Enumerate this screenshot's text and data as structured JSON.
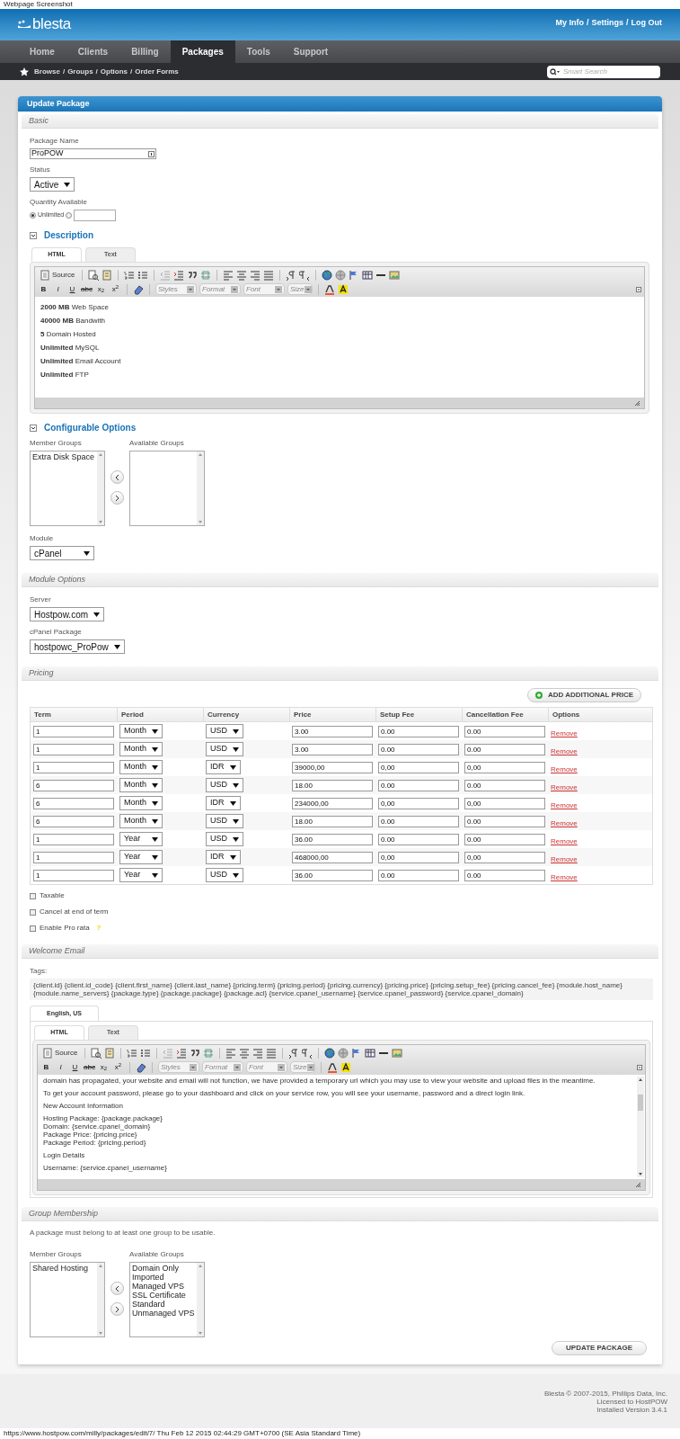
{
  "page_caption": "Webpage Screenshot",
  "header": {
    "logo": "blesta",
    "user_links": [
      "My Info",
      "Settings",
      "Log Out"
    ],
    "separator": "/"
  },
  "nav": [
    {
      "label": "Home",
      "selected": false
    },
    {
      "label": "Clients",
      "selected": false
    },
    {
      "label": "Billing",
      "selected": false
    },
    {
      "label": "Packages",
      "selected": true
    },
    {
      "label": "Tools",
      "selected": false
    },
    {
      "label": "Support",
      "selected": false
    }
  ],
  "subnav": {
    "links": [
      "Browse",
      "Groups",
      "Options",
      "Order Forms"
    ],
    "separator": "/",
    "search_placeholder": "Smart Search"
  },
  "panel_title": "Update Package",
  "basic": {
    "title": "Basic",
    "package_name_label": "Package Name",
    "package_name": "ProPOW",
    "status_label": "Status",
    "status": "Active",
    "quantity_label": "Quantity Available",
    "unlimited_label": "Unlimited",
    "unlimited_selected": true
  },
  "description": {
    "title": "Description",
    "expanded": true,
    "tabs": [
      {
        "label": "HTML",
        "selected": true
      },
      {
        "label": "Text",
        "selected": false
      }
    ],
    "toolbar": {
      "source": "Source",
      "format_buttons": [
        "B",
        "I",
        "U",
        "abc",
        "x$_{2}$",
        "x$^{2}$"
      ],
      "dropdowns": [
        "Styles",
        "Format",
        "Font",
        "Size"
      ]
    },
    "lines": [
      "**2000 MB** Web Space",
      "**40000 MB** Bandwith",
      "**5** Domain Hosted",
      "**Unlimited** MySQL",
      "**Unlimited** Email Account",
      "**Unlimited** FTP"
    ]
  },
  "configurable_options": {
    "title": "Configurable Options",
    "expanded": true,
    "member_groups_label": "Member Groups",
    "member_groups": [
      "Extra Disk Space"
    ],
    "available_groups_label": "Available Groups",
    "module_label": "Module",
    "module": "cPanel"
  },
  "module_options": {
    "title": "Module Options",
    "server_label": "Server",
    "server": "Hostpow.com",
    "package_label": "cPanel Package",
    "package": "hostpowc_ProPow"
  },
  "pricing": {
    "title": "Pricing",
    "add_button": "ADD ADDITIONAL PRICE",
    "columns": [
      "Term",
      "Period",
      "Currency",
      "Price",
      "Setup Fee",
      "Cancellation Fee",
      "Options"
    ],
    "rows": [
      {
        "term": "1",
        "period": "Month",
        "currency": "USD",
        "price": "3.00",
        "setup_fee": "0.00",
        "cancellation_fee": "0.00",
        "action": "Remove"
      },
      {
        "term": "1",
        "period": "Month",
        "currency": "USD",
        "price": "3.00",
        "setup_fee": "0.00",
        "cancellation_fee": "0.00",
        "action": "Remove"
      },
      {
        "term": "1",
        "period": "Month",
        "currency": "IDR",
        "price": "39000,00",
        "setup_fee": "0,00",
        "cancellation_fee": "0,00",
        "action": "Remove"
      },
      {
        "term": "6",
        "period": "Month",
        "currency": "USD",
        "price": "18.00",
        "setup_fee": "0.00",
        "cancellation_fee": "0.00",
        "action": "Remove"
      },
      {
        "term": "6",
        "period": "Month",
        "currency": "IDR",
        "price": "234000,00",
        "setup_fee": "0,00",
        "cancellation_fee": "0,00",
        "action": "Remove"
      },
      {
        "term": "6",
        "period": "Month",
        "currency": "USD",
        "price": "18.00",
        "setup_fee": "0.00",
        "cancellation_fee": "0.00",
        "action": "Remove"
      },
      {
        "term": "1",
        "period": "Year",
        "currency": "USD",
        "price": "36.00",
        "setup_fee": "0.00",
        "cancellation_fee": "0.00",
        "action": "Remove"
      },
      {
        "term": "1",
        "period": "Year",
        "currency": "IDR",
        "price": "468000,00",
        "setup_fee": "0,00",
        "cancellation_fee": "0,00",
        "action": "Remove"
      },
      {
        "term": "1",
        "period": "Year",
        "currency": "USD",
        "price": "36.00",
        "setup_fee": "0.00",
        "cancellation_fee": "0.00",
        "action": "Remove"
      }
    ],
    "checkboxes": [
      {
        "label": "Taxable",
        "checked": false
      },
      {
        "label": "Cancel at end of term",
        "checked": false
      },
      {
        "label": "Enable Pro rata",
        "checked": false,
        "help": "?"
      }
    ]
  },
  "welcome_email": {
    "title": "Welcome Email",
    "tags_label": "Tags:",
    "tags": "{client.id} {client.id_code} {client.first_name} {client.last_name} {pricing.term} {pricing.period} {pricing.currency} {pricing.price} {pricing.setup_fee} {pricing.cancel_fee} {module.host_name} {module.name_servers} {package.type} {package.package} {package.acl} {service.cpanel_username} {service.cpanel_password} {service.cpanel_domain}",
    "language_tabs": [
      {
        "label": "English, US",
        "selected": true
      }
    ],
    "tabs": [
      {
        "label": "HTML",
        "selected": true
      },
      {
        "label": "Text",
        "selected": false
      }
    ],
    "toolbar": {
      "source": "Source",
      "format_buttons": [
        "B",
        "I",
        "U",
        "abc",
        "x$_{2}$",
        "x$^{2}$"
      ],
      "dropdowns": [
        "Styles",
        "Format",
        "Font",
        "Size"
      ]
    },
    "paragraphs": [
      [
        "domain has propagated, your website and email will not function, we have provided a temporary url which you may use to view your website and upload files in the meantime."
      ],
      [
        "To get your account password, please go to your dashboard and click on your service row, you will see your username, password and a direct login link."
      ],
      [
        "New Account Information"
      ],
      [
        "Hosting Package: {package.package}",
        "Domain: {service.cpanel_domain}",
        "Package Price: {pricing.price}",
        "Package Period: {pricing.period}"
      ],
      [
        "Login Details"
      ],
      [
        "Username: {service.cpanel_username}"
      ]
    ]
  },
  "group_membership": {
    "title": "Group Membership",
    "note": "A package must belong to at least one group to be usable.",
    "member_groups_label": "Member Groups",
    "member_groups": [
      "Shared Hosting"
    ],
    "available_groups_label": "Available Groups",
    "available_groups": [
      "Domain Only",
      "Imported",
      "Managed VPS",
      "SSL Certificate",
      "Standard",
      "Unmanaged VPS"
    ]
  },
  "submit_button": "UPDATE PACKAGE",
  "footer": [
    "Blesta © 2007-2015, Phillips Data, Inc.",
    "Licensed to HostPOW",
    "Installed Version 3.4.1"
  ],
  "status_line": "https://www.hostpow.com/milly/packages/edit/7/ Thu Feb 12 2015 02:44:29 GMT+0700 (SE Asia Standard Time)"
}
